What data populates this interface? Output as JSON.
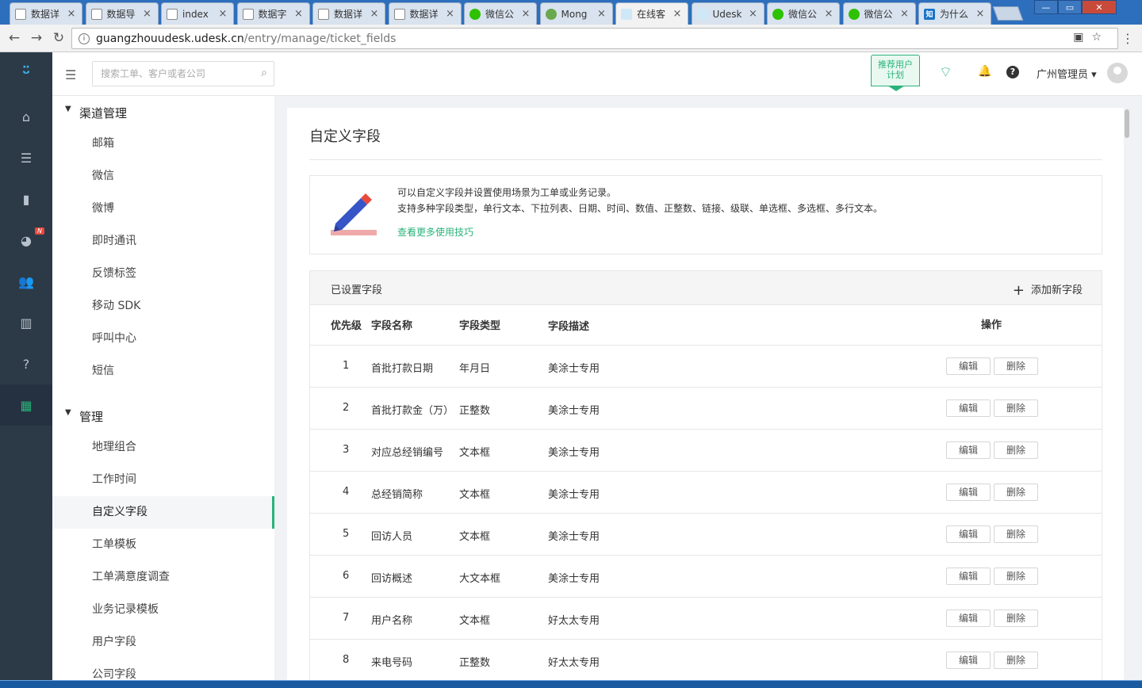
{
  "browser": {
    "tabs": [
      {
        "label": "数据详",
        "icon": "doc"
      },
      {
        "label": "数据导",
        "icon": "doc"
      },
      {
        "label": "index",
        "icon": "doc"
      },
      {
        "label": "数据字",
        "icon": "doc"
      },
      {
        "label": "数据详",
        "icon": "doc"
      },
      {
        "label": "数据详",
        "icon": "doc"
      },
      {
        "label": "微信公",
        "icon": "wx"
      },
      {
        "label": "Mong",
        "icon": "mongo"
      },
      {
        "label": "在线客",
        "icon": "udesk"
      },
      {
        "label": "Udesk",
        "icon": "udesk"
      },
      {
        "label": "微信公",
        "icon": "wx"
      },
      {
        "label": "微信公",
        "icon": "wx"
      },
      {
        "label": "为什么",
        "icon": "zhi",
        "icon_text": "知"
      }
    ],
    "active_tab": 8,
    "url_host": "guangzhouudesk.udesk.cn",
    "url_path": "/entry/manage/ticket_fields"
  },
  "header": {
    "search_placeholder": "搜索工单、客户或者公司",
    "promo_line1": "推荐用户",
    "promo_line2": "计划",
    "user_name": "广州管理员"
  },
  "rail": {
    "items": [
      "home-icon",
      "list-icon",
      "chart-icon",
      "pie-icon",
      "users-icon",
      "book-icon",
      "help-icon",
      "apps-icon"
    ],
    "badge": "N",
    "selected": "apps-icon"
  },
  "subnav": {
    "group1": "渠道管理",
    "group1_items": [
      "邮箱",
      "微信",
      "微博",
      "即时通讯",
      "反馈标签",
      "移动 SDK",
      "呼叫中心",
      "短信"
    ],
    "group2": "管理",
    "group2_items": [
      "地理组合",
      "工作时间",
      "自定义字段",
      "工单模板",
      "工单满意度调查",
      "业务记录模板",
      "用户字段",
      "公司字段"
    ],
    "selected": "自定义字段"
  },
  "page": {
    "title": "自定义字段",
    "tip_line1": "可以自定义字段并设置使用场景为工单或业务记录。",
    "tip_line2": "支持多种字段类型，单行文本、下拉列表、日期、时间、数值、正整数、链接、级联、单选框、多选框、多行文本。",
    "tip_link": "查看更多使用技巧",
    "table_label": "已设置字段",
    "add_label": "添加新字段",
    "columns": [
      "优先级",
      "字段名称",
      "字段类型",
      "字段描述",
      "操作"
    ],
    "edit_label": "编辑",
    "delete_label": "删除",
    "rows": [
      {
        "priority": "1",
        "name": "首批打款日期",
        "type": "年月日",
        "desc": "美涂士专用"
      },
      {
        "priority": "2",
        "name": "首批打款金（万）",
        "type": "正整数",
        "desc": "美涂士专用"
      },
      {
        "priority": "3",
        "name": "对应总经销编号",
        "type": "文本框",
        "desc": "美涂士专用"
      },
      {
        "priority": "4",
        "name": "总经销简称",
        "type": "文本框",
        "desc": "美涂士专用"
      },
      {
        "priority": "5",
        "name": "回访人员",
        "type": "文本框",
        "desc": "美涂士专用"
      },
      {
        "priority": "6",
        "name": "回访概述",
        "type": "大文本框",
        "desc": "美涂士专用"
      },
      {
        "priority": "7",
        "name": "用户名称",
        "type": "文本框",
        "desc": "好太太专用"
      },
      {
        "priority": "8",
        "name": "来电号码",
        "type": "正整数",
        "desc": "好太太专用"
      }
    ]
  },
  "colors": {
    "accent": "#29b37a",
    "rail": "#2c3a47",
    "link": "#29b37a"
  }
}
